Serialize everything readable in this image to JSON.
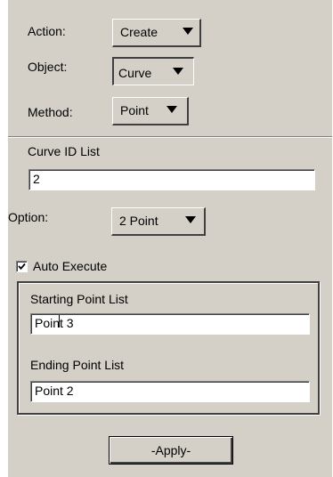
{
  "form": {
    "action": {
      "label": "Action:",
      "value": "Create"
    },
    "object": {
      "label": "Object:",
      "value": "Curve"
    },
    "method": {
      "label": "Method:",
      "value": "Point"
    },
    "curve_id_list": {
      "label": "Curve ID List",
      "value": "2"
    },
    "option": {
      "label": "Option:",
      "value": "2 Point"
    },
    "auto_execute": {
      "label": "Auto Execute",
      "checked": true
    },
    "starting_point_list": {
      "label": "Starting Point List",
      "value": "Point 3"
    },
    "ending_point_list": {
      "label": "Ending Point List",
      "value": "Point 2"
    },
    "apply_label": "-Apply-"
  },
  "colors": {
    "panel_background": "#d4d0c8",
    "field_background": "#ffffff"
  }
}
